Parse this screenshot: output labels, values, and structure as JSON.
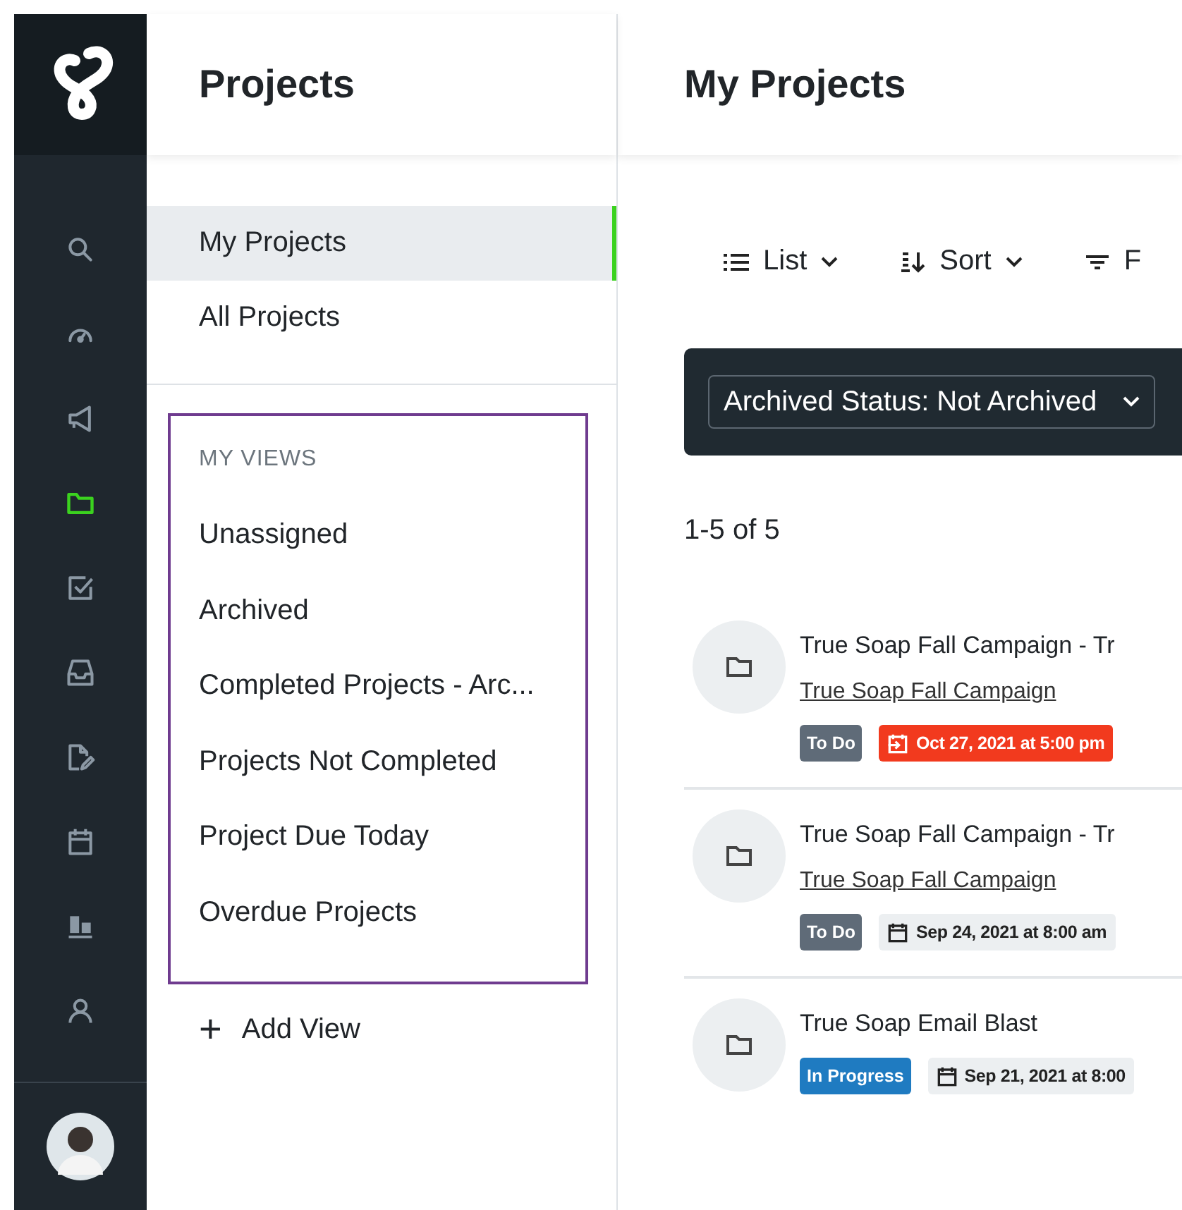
{
  "rail": {
    "items": [
      {
        "kind": "search",
        "selected": false
      },
      {
        "kind": "gauge",
        "selected": false
      },
      {
        "kind": "megaphone",
        "selected": false
      },
      {
        "kind": "folder",
        "selected": true
      },
      {
        "kind": "checkbox",
        "selected": false
      },
      {
        "kind": "inbox",
        "selected": false
      },
      {
        "kind": "document",
        "selected": false
      },
      {
        "kind": "calendar",
        "selected": false
      },
      {
        "kind": "chart",
        "selected": false
      },
      {
        "kind": "person",
        "selected": false
      }
    ]
  },
  "panel": {
    "title": "Projects",
    "nav": [
      {
        "label": "My Projects",
        "selected": true
      },
      {
        "label": "All Projects",
        "selected": false
      }
    ],
    "views": {
      "heading": "MY VIEWS",
      "items": [
        "Unassigned",
        "Archived",
        "Completed Projects - Arc...",
        "Projects Not Completed",
        "Project Due Today",
        "Overdue Projects"
      ]
    },
    "add_view": {
      "icon": "+",
      "label": "Add View"
    }
  },
  "main": {
    "title": "My Projects",
    "toolbar": [
      {
        "kind": "list",
        "label": "List",
        "dropdown": true
      },
      {
        "kind": "sort",
        "label": "Sort",
        "dropdown": true
      },
      {
        "kind": "filter",
        "label": "F",
        "dropdown": false
      }
    ],
    "filter": {
      "value": "Archived Status: Not Archived"
    },
    "count": "1-5 of 5",
    "rows": [
      {
        "title": "True Soap Fall Campaign - Tr",
        "link": "True Soap Fall Campaign",
        "status": "To Do",
        "color": "#5f6b78",
        "due": "Oct 27, 2021 at 5:00 pm",
        "overdue": true
      },
      {
        "title": "True Soap Fall Campaign - Tr",
        "link": "True Soap Fall Campaign",
        "status": "To Do",
        "color": "#5f6b78",
        "due": "Sep 24, 2021 at 8:00 am",
        "overdue": false
      },
      {
        "title": "True Soap Email Blast",
        "status": "In Progress",
        "color": "#1f7bc1",
        "due": "Sep 21, 2021 at 8:00",
        "overdue": false
      }
    ]
  }
}
